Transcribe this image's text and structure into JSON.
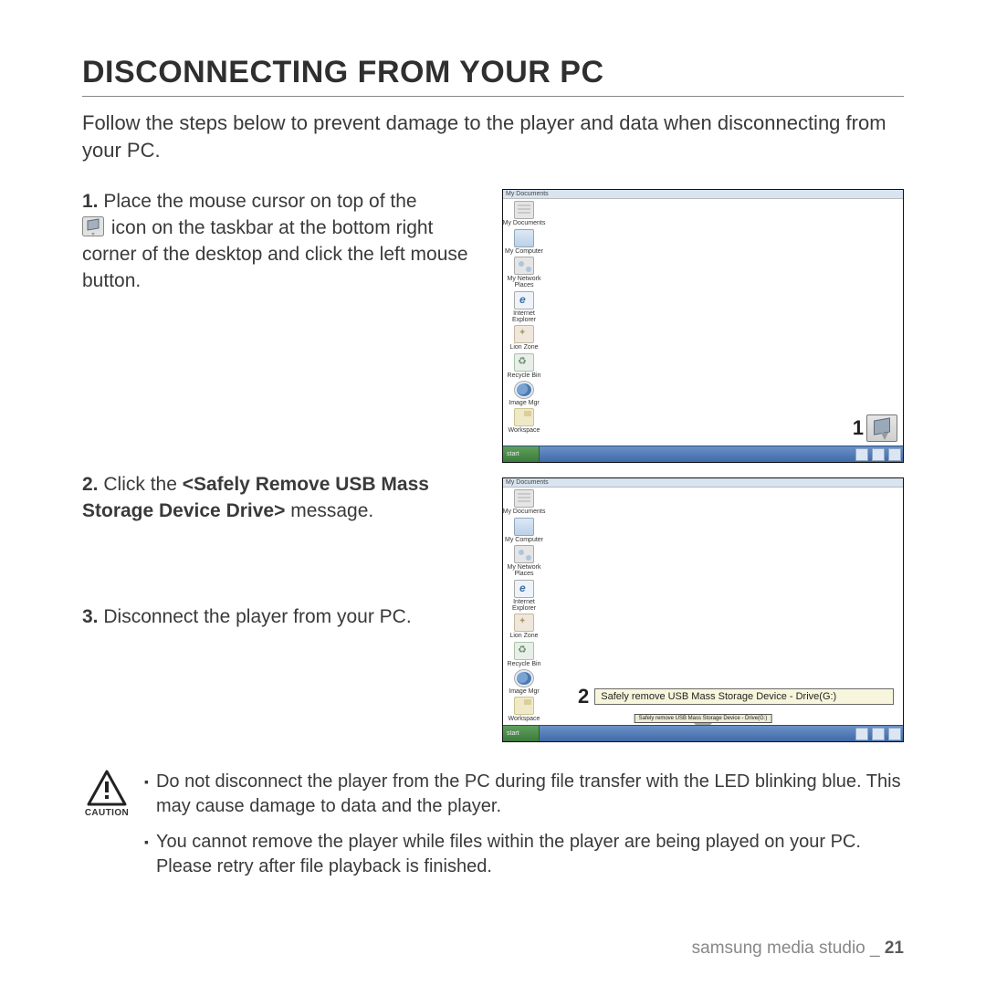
{
  "title": "DISCONNECTING FROM YOUR PC",
  "intro": "Follow the steps below to prevent damage to the player and data when disconnecting from your PC.",
  "steps": {
    "s1": {
      "num": "1.",
      "text_a": "Place the mouse cursor on top of the",
      "text_b": "icon on the taskbar at the bottom right corner of the desktop and click the left mouse button."
    },
    "s2": {
      "num": "2.",
      "text_a": "Click the ",
      "bold": "<Safely Remove USB Mass Storage Device Drive>",
      "text_b": " message."
    },
    "s3": {
      "num": "3.",
      "text": "Disconnect the player from your PC."
    }
  },
  "callouts": {
    "one": "1",
    "two": "2"
  },
  "screenshots": {
    "top_bar_1": "My Documents",
    "top_bar_2": "My Documents",
    "icons": [
      {
        "cls": "docs",
        "label": "My Documents"
      },
      {
        "cls": "comp",
        "label": "My Computer"
      },
      {
        "cls": "net",
        "label": "My Network\nPlaces"
      },
      {
        "cls": "ie",
        "label": "Internet\nExplorer"
      },
      {
        "cls": "paw",
        "label": "Lion Zone"
      },
      {
        "cls": "recycle",
        "label": "Recycle Bin"
      },
      {
        "cls": "globe",
        "label": "Image Mgr"
      },
      {
        "cls": "folder",
        "label": "Workspace"
      }
    ],
    "start": "start",
    "tooltip": "Safely remove USB Mass Storage Device - Drive(G:)",
    "taskbar_chip": "Safely remove USB Mass Storage Device - Drive(G:)"
  },
  "caution": {
    "label": "CAUTION",
    "items": [
      "Do not disconnect the player from the PC during file transfer with the LED blinking blue. This may cause damage to data and the player.",
      "You cannot remove the player while files within the player are being played on your PC. Please retry after file playback is finished."
    ]
  },
  "footer": {
    "text": "samsung media studio _ ",
    "page": "21"
  }
}
